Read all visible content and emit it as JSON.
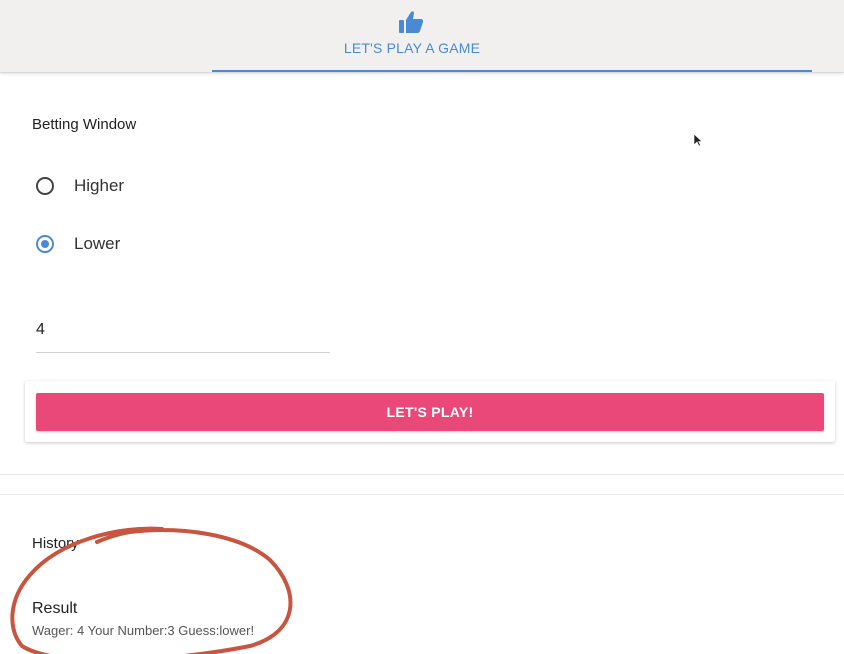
{
  "tabs": {
    "active_label": "LET'S PLAY A GAME",
    "icon": "thumbs-up-icon"
  },
  "betting": {
    "title": "Betting Window",
    "options": [
      {
        "label": "Higher",
        "selected": false
      },
      {
        "label": "Lower",
        "selected": true
      }
    ],
    "wager_value": "4",
    "play_button_label": "LET'S PLAY!"
  },
  "history": {
    "title": "History",
    "result_title": "Result",
    "result_detail": "Wager: 4 Your Number:3 Guess:lower!"
  },
  "colors": {
    "accent": "#4a8ad4",
    "button": "#ea4879",
    "annotation": "#c8553f"
  }
}
